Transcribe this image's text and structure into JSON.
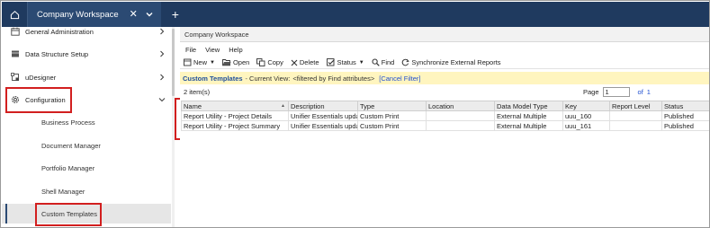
{
  "topbar": {
    "tab_label": "Company Workspace",
    "tab_close": "✕",
    "add_tab": "+"
  },
  "sidebar": {
    "items": [
      {
        "label": "General Administration",
        "icon": "calendar-icon"
      },
      {
        "label": "Data Structure Setup",
        "icon": "cube-icon"
      },
      {
        "label": "uDesigner",
        "icon": "designer-icon"
      },
      {
        "label": "Configuration",
        "icon": "gear-icon"
      }
    ],
    "sub_items": [
      {
        "label": "Business Process"
      },
      {
        "label": "Document Manager"
      },
      {
        "label": "Portfolio Manager"
      },
      {
        "label": "Shell Manager"
      },
      {
        "label": "Custom Templates"
      }
    ]
  },
  "main": {
    "title": "Company Workspace",
    "menu": [
      "File",
      "View",
      "Help"
    ],
    "toolbar": {
      "new": "New",
      "open": "Open",
      "copy": "Copy",
      "delete": "Delete",
      "status": "Status",
      "find": "Find",
      "sync": "Synchronize External Reports"
    },
    "filter": {
      "title": "Custom Templates",
      "sep": "-",
      "view_label": "Current View:",
      "view_value": "<filtered by Find attributes>",
      "cancel": "[Cancel Filter]"
    },
    "item_count": "2 item(s)",
    "pager": {
      "label": "Page",
      "value": "1",
      "of": "of",
      "total": "1"
    },
    "table": {
      "columns": [
        "Name",
        "Description",
        "Type",
        "Location",
        "Data Model Type",
        "Key",
        "Report Level",
        "Status"
      ],
      "rows": [
        [
          "Report Utility - Project Details",
          "Unifier Essentials upda",
          "Custom Print",
          "",
          "External Multiple",
          "uuu_160",
          "",
          "Published"
        ],
        [
          "Report Utility - Project Summary",
          "Unifier Essentials upda",
          "Custom Print",
          "",
          "External Multiple",
          "uuu_161",
          "",
          "Published"
        ]
      ]
    }
  },
  "colors": {
    "topbar": "#1f3a5f",
    "tab_active": "#2b4a73",
    "filter_bg": "#fff5bf",
    "highlight": "#d21f1f",
    "link": "#1f4fd0"
  }
}
